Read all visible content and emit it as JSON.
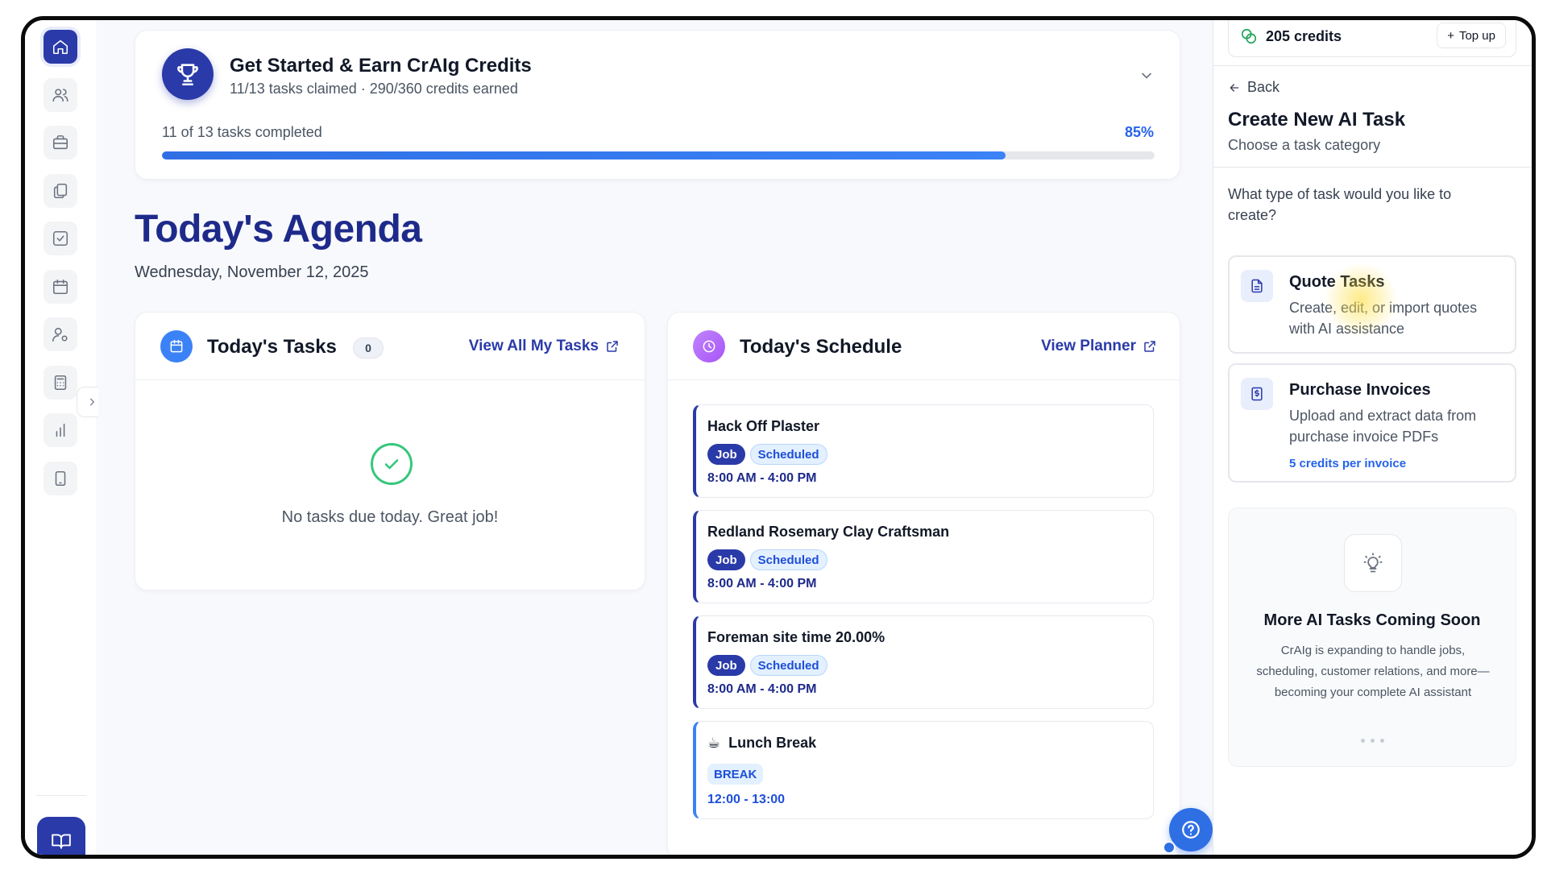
{
  "onboarding": {
    "title": "Get Started & Earn CrAIg Credits",
    "subtitle": "11/13 tasks claimed · 290/360 credits earned",
    "progress_label": "11 of 13 tasks completed",
    "progress_percent_text": "85%",
    "progress_percent": 85
  },
  "agenda": {
    "title": "Today's Agenda",
    "date": "Wednesday, November 12, 2025"
  },
  "tasks_card": {
    "title": "Today's Tasks",
    "count": "0",
    "link": "View All My Tasks",
    "empty_text": "No tasks due today. Great job!"
  },
  "schedule_card": {
    "title": "Today's Schedule",
    "link": "View Planner",
    "items": [
      {
        "title": "Hack Off Plaster",
        "type": "Job",
        "status": "Scheduled",
        "time": "8:00 AM - 4:00 PM"
      },
      {
        "title": "Redland Rosemary Clay Craftsman",
        "type": "Job",
        "status": "Scheduled",
        "time": "8:00 AM - 4:00 PM"
      },
      {
        "title": "Foreman site time 20.00%",
        "type": "Job",
        "status": "Scheduled",
        "time": "8:00 AM - 4:00 PM"
      },
      {
        "title": "Lunch Break",
        "type": "BREAK",
        "time": "12:00 - 13:00",
        "emoji": "☕"
      }
    ]
  },
  "panel": {
    "credits": "205 credits",
    "topup": "Top up",
    "back": "Back",
    "title": "Create New AI Task",
    "subtitle": "Choose a task category",
    "question": "What type of task would you like to create?",
    "options": [
      {
        "title": "Quote Tasks",
        "desc": "Create, edit, or import quotes with AI assistance"
      },
      {
        "title": "Purchase Invoices",
        "desc": "Upload and extract data from purchase invoice PDFs",
        "credit": "5 credits per invoice"
      }
    ],
    "coming": {
      "title": "More AI Tasks Coming Soon",
      "desc": "CrAIg is expanding to handle jobs, scheduling, customer relations, and more—becoming your complete AI assistant"
    }
  },
  "colors": {
    "brand": "#2a3aa8",
    "accent_blue": "#2f6fe4",
    "success": "#34c77b",
    "purple": "#a855f7"
  }
}
